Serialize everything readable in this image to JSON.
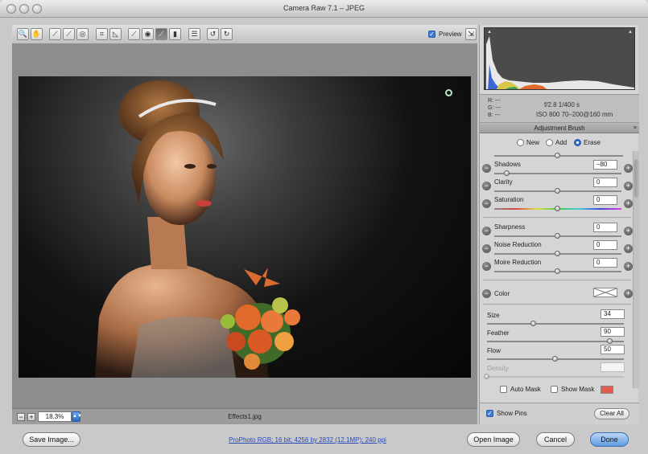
{
  "window": {
    "title": "Camera Raw 7.1  –  JPEG"
  },
  "toolbar": {
    "tools": [
      {
        "name": "zoom-tool",
        "glyph": "🔍"
      },
      {
        "name": "hand-tool",
        "glyph": "✋"
      },
      {
        "name": "white-balance-tool",
        "glyph": "⟋"
      },
      {
        "name": "color-sampler-tool",
        "glyph": "⟋"
      },
      {
        "name": "targeted-adjustment-tool",
        "glyph": "◎"
      },
      {
        "name": "crop-tool",
        "glyph": "⌗"
      },
      {
        "name": "straighten-tool",
        "glyph": "◺"
      },
      {
        "name": "spot-removal-tool",
        "glyph": "⟋"
      },
      {
        "name": "red-eye-tool",
        "glyph": "◉"
      },
      {
        "name": "adjustment-brush-tool",
        "glyph": "⟋"
      },
      {
        "name": "graduated-filter-tool",
        "glyph": "▮"
      },
      {
        "name": "preferences-tool",
        "glyph": "☰"
      },
      {
        "name": "rotate-ccw-tool",
        "glyph": "↺"
      },
      {
        "name": "rotate-cw-tool",
        "glyph": "↻"
      }
    ],
    "preview_checked": "✓",
    "preview_label": "Preview",
    "fullscreen_glyph": "⇲"
  },
  "status": {
    "zoom_minus": "−",
    "zoom_plus": "+",
    "zoom_value": "18.3%",
    "filename": "Effects1.jpg"
  },
  "readout": {
    "r": "R:   ---",
    "g": "G:   ---",
    "b": "B:   ---",
    "exposure": "f/2.8    1/400 s",
    "iso_lens": "ISO 800   70–200@160 mm"
  },
  "panel": {
    "title": "Adjustment Brush",
    "menu_glyph": "≡",
    "modes": [
      "New",
      "Add",
      "Erase"
    ],
    "selected_mode": "Erase"
  },
  "sliders": {
    "shadows": {
      "label": "Shadows",
      "value": "–80",
      "position": 0.1
    },
    "clarity": {
      "label": "Clarity",
      "value": "0",
      "position": 0.5
    },
    "saturation": {
      "label": "Saturation",
      "value": "0",
      "position": 0.5
    },
    "sharpness": {
      "label": "Sharpness",
      "value": "0",
      "position": 0.5
    },
    "noise_reduction": {
      "label": "Noise Reduction",
      "value": "0",
      "position": 0.5
    },
    "moire_reduction": {
      "label": "Moire Reduction",
      "value": "0",
      "position": 0.5
    },
    "color": {
      "label": "Color"
    }
  },
  "brush": {
    "size": {
      "label": "Size",
      "value": "34",
      "position": 0.34
    },
    "feather": {
      "label": "Feather",
      "value": "90",
      "position": 0.9
    },
    "flow": {
      "label": "Flow",
      "value": "50",
      "position": 0.5
    },
    "density": {
      "label": "Density",
      "value": "",
      "position": 0.0
    }
  },
  "mask": {
    "auto_mask_label": "Auto Mask",
    "show_mask_label": "Show Mask",
    "show_mask_color": "#e25c4d"
  },
  "pins": {
    "show_pins_label": "Show Pins",
    "show_pins_checked": "✓",
    "clear_all_label": "Clear All"
  },
  "footer": {
    "save_label": "Save Image...",
    "workflow_text": "ProPhoto RGB; 16 bit; 4256 by 2832 (12.1MP); 240 ppi",
    "open_label": "Open Image",
    "cancel_label": "Cancel",
    "done_label": "Done"
  },
  "colors": {
    "accent": "#3d7bd6",
    "link": "#2a47b7",
    "pin_ring": "#b9e6c5"
  }
}
